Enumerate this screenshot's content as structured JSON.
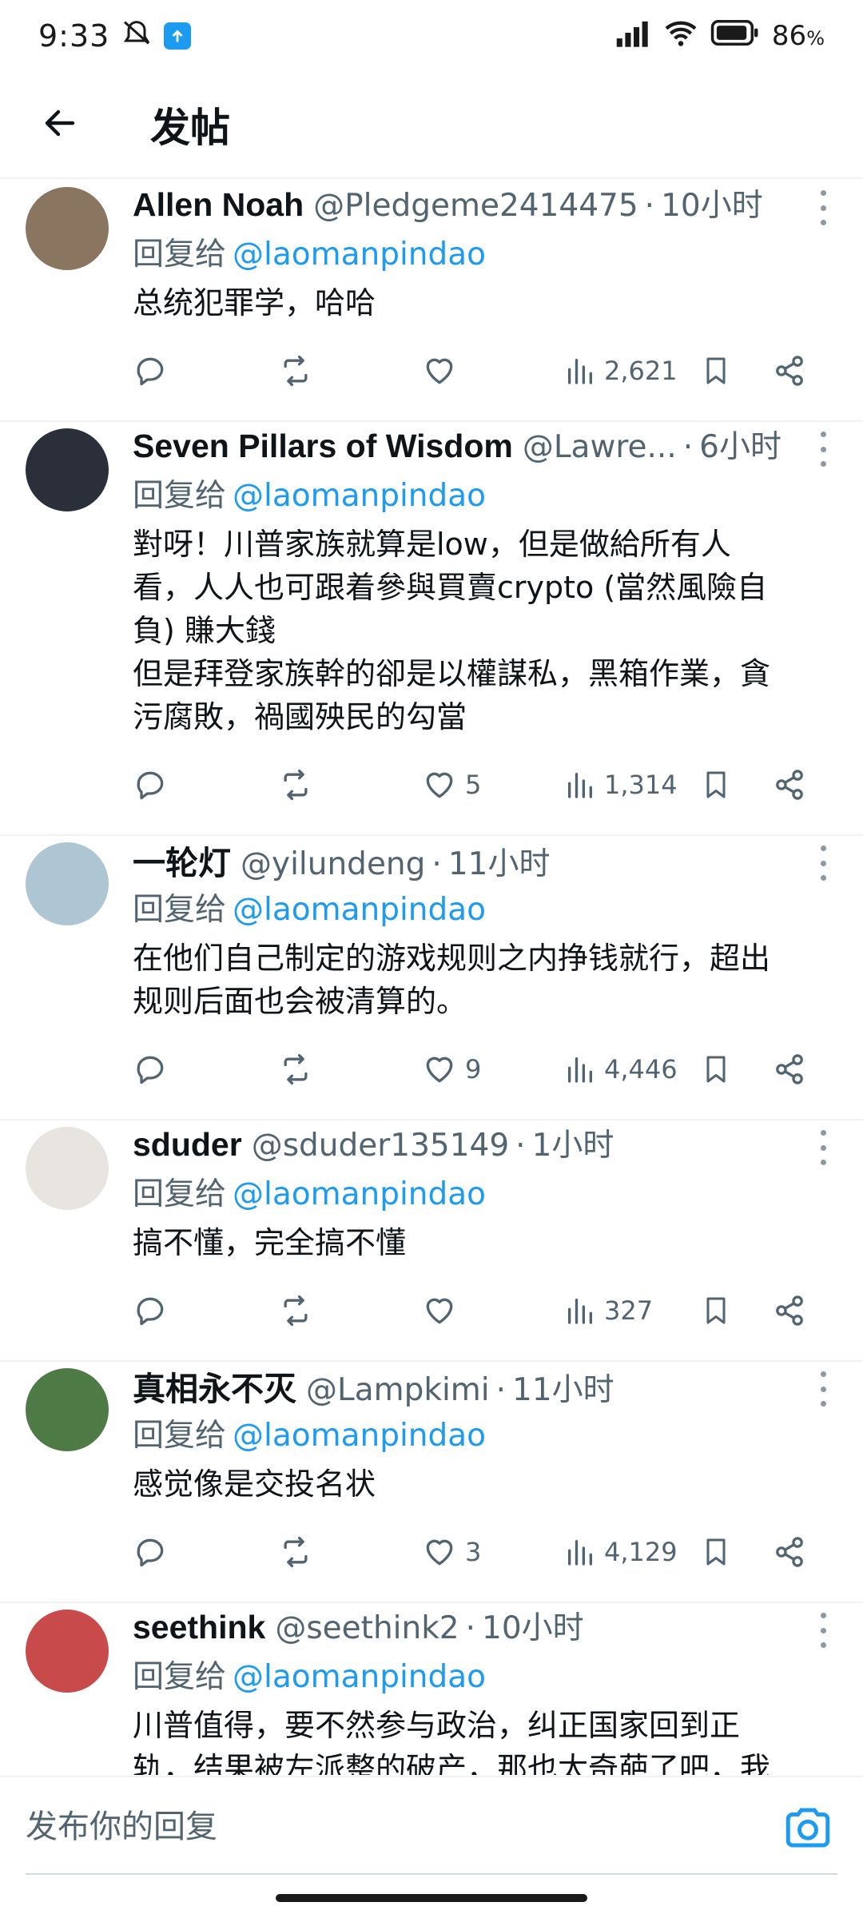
{
  "status_bar": {
    "time": "9:33",
    "battery": "86",
    "battery_unit": "%",
    "icons": [
      "mute-icon",
      "upload-app-icon",
      "signal-icon",
      "wifi-icon",
      "battery-icon"
    ]
  },
  "header": {
    "back_icon": "arrow-left-icon",
    "title": "发帖"
  },
  "reply_to_label": "回复给",
  "posts": [
    {
      "name": "Allen Noah",
      "handle": "@Pledgeme2414475",
      "time": "10小时",
      "mention": "@laomanpindao",
      "text": "总统犯罪学，哈哈",
      "likes": "",
      "views": "2,621",
      "avatar_color": "#8a7560"
    },
    {
      "name": "Seven Pillars of Wisdom",
      "handle": "@Lawre...",
      "time": "6小时",
      "mention": "@laomanpindao",
      "text": "對呀！川普家族就算是low，但是做給所有人\n看，人人也可跟着參與買賣crypto (當然風險自\n負) 賺大錢\n但是拜登家族幹的卻是以權謀私，黑箱作業，貪\n污腐敗，禍國殃民的勾當",
      "likes": "5",
      "views": "1,314",
      "avatar_color": "#2a2f3a"
    },
    {
      "name": "一轮灯",
      "handle": "@yilundeng",
      "time": "11小时",
      "mention": "@laomanpindao",
      "text": "在他们自己制定的游戏规则之内挣钱就行，超出\n规则后面也会被清算的。",
      "likes": "9",
      "views": "4,446",
      "avatar_color": "#aec6d3"
    },
    {
      "name": "sduder",
      "handle": "@sduder135149",
      "time": "1小时",
      "mention": "@laomanpindao",
      "text": "搞不懂，完全搞不懂",
      "likes": "",
      "views": "327",
      "avatar_color": "#e8e4e0"
    },
    {
      "name": "真相永不灭",
      "handle": "@Lampkimi",
      "time": "11小时",
      "mention": "@laomanpindao",
      "text": "感觉像是交投名状",
      "likes": "3",
      "views": "4,129",
      "avatar_color": "#4d7a45"
    },
    {
      "name": "seethink",
      "handle": "@seethink2",
      "time": "10小时",
      "mention": "@laomanpindao",
      "text": "川普值得，要不然参与政治，纠正国家回到正\n轨，结果被左派整的破产，那也太奇葩了吧，我\n看民起太发动，只断在，川普就该在还差的时候",
      "likes": "",
      "views": "",
      "avatar_color": "#c84a4a"
    }
  ],
  "reply_bar": {
    "placeholder": "发布你的回复",
    "camera_icon": "camera-icon"
  },
  "colors": {
    "accent": "#1d9bf0",
    "secondary_text": "#536471",
    "divider": "#eff3f4"
  }
}
